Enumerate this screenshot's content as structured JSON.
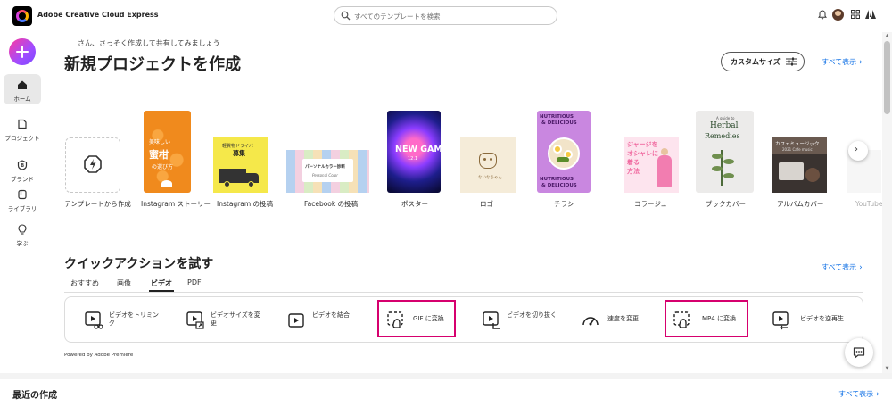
{
  "app": {
    "title": "Adobe Creative Cloud Express"
  },
  "search": {
    "placeholder": "すべてのテンプレートを検索"
  },
  "topbar": {
    "icons": [
      "bell-icon",
      "avatar",
      "apps-grid-icon",
      "adobe-logo-icon"
    ]
  },
  "sidebar": {
    "items": [
      {
        "label": "ホーム",
        "icon": "home-icon",
        "active": true
      },
      {
        "label": "プロジェクト",
        "icon": "project-icon"
      },
      {
        "label": "ブランド",
        "icon": "brand-icon"
      },
      {
        "label": "ライブラリ",
        "icon": "library-icon"
      },
      {
        "label": "学ぶ",
        "icon": "learn-icon"
      }
    ]
  },
  "hero": {
    "greeting": "さん、さっそく作成して共有してみましょう",
    "title": "新規プロジェクトを作成",
    "custom_size": "カスタムサイズ",
    "see_all": "すべて表示"
  },
  "templates": [
    {
      "label": "テンプレートから作成"
    },
    {
      "label": "Instagram ストーリー",
      "thumb_text": [
        "美味しい",
        "蜜柑",
        "の選び方"
      ],
      "color": "#f08a1d"
    },
    {
      "label": "Instagram の投稿",
      "thumb_text": [
        "軽貨物ドライバー",
        "募集"
      ],
      "color": "#f5e84a"
    },
    {
      "label": "Facebook の投稿",
      "thumb_text": [
        "パーソナルカラー診断",
        "Personal Color"
      ],
      "color": "#d9c3e6"
    },
    {
      "label": "ポスター",
      "thumb_text": [
        "NEW GAME",
        "12.1"
      ],
      "color": "#1e1e8c"
    },
    {
      "label": "ロゴ",
      "thumb_text": [
        "ないなちゃん"
      ],
      "color": "#f5ecd9"
    },
    {
      "label": "チラシ",
      "thumb_text": [
        "NUTRITIOUS",
        "& DELICIOUS"
      ],
      "color": "#c987e0"
    },
    {
      "label": "コラージュ",
      "thumb_text": [
        "ジャージを",
        "オシャレに",
        "着る",
        "方法"
      ],
      "color": "#fde4ee"
    },
    {
      "label": "ブックカバー",
      "thumb_text": [
        "A guide to",
        "Herbal",
        "Remedies"
      ],
      "color": "#ecebea"
    },
    {
      "label": "アルバムカバー",
      "thumb_text": [
        "カフェミュージック",
        "2021 Cafe music"
      ],
      "color": "#3a3330"
    },
    {
      "label": "YouTube"
    }
  ],
  "quick_actions": {
    "title": "クイックアクションを試す",
    "see_all": "すべて表示",
    "tabs": [
      "おすすめ",
      "画像",
      "ビデオ",
      "PDF"
    ],
    "active_tab": "ビデオ",
    "items": [
      {
        "label": "ビデオをトリミング",
        "icon": "video-trim-icon"
      },
      {
        "label": "ビデオサイズを変更",
        "icon": "video-resize-icon"
      },
      {
        "label": "ビデオを結合",
        "icon": "video-merge-icon"
      },
      {
        "label": "GIF に変換",
        "icon": "gif-convert-icon",
        "highlighted": true
      },
      {
        "label": "ビデオを切り抜く",
        "icon": "video-crop-icon"
      },
      {
        "label": "速度を変更",
        "icon": "speed-icon"
      },
      {
        "label": "MP4 に変換",
        "icon": "mp4-convert-icon",
        "highlighted": true
      },
      {
        "label": "ビデオを逆再生",
        "icon": "video-reverse-icon"
      }
    ],
    "powered_by": "Powered by Adobe Premiere"
  },
  "recent": {
    "title": "最近の作成",
    "see_all": "すべて表示"
  },
  "colors": {
    "accent": "#1473e6",
    "highlight": "#d6006e",
    "fab_start": "#ff3a9d",
    "fab_end": "#7b49ff"
  }
}
